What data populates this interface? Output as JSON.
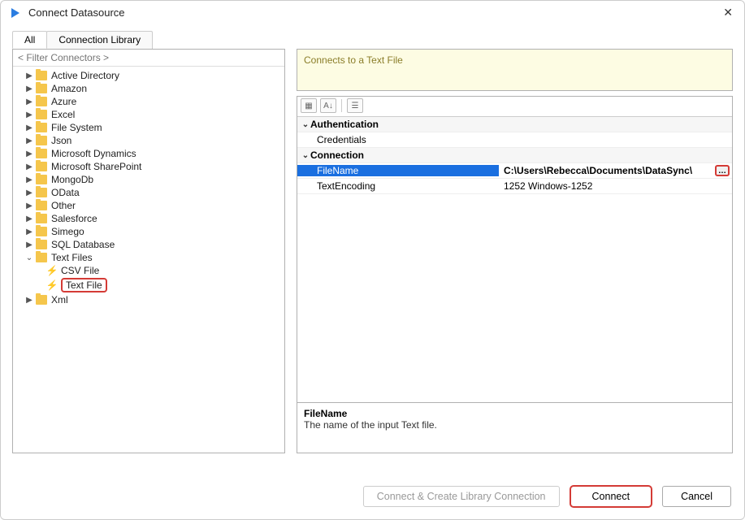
{
  "window": {
    "title": "Connect Datasource"
  },
  "tabs": [
    {
      "label": "All",
      "active": true
    },
    {
      "label": "Connection Library",
      "active": false
    }
  ],
  "filter_placeholder": "< Filter Connectors >",
  "tree": {
    "folders_collapsed": [
      "Active Directory",
      "Amazon",
      "Azure",
      "Excel",
      "File System",
      "Json",
      "Microsoft Dynamics",
      "Microsoft SharePoint",
      "MongoDb",
      "OData",
      "Other",
      "Salesforce",
      "Simego",
      "SQL Database"
    ],
    "expanded": {
      "label": "Text Files",
      "children": [
        {
          "label": "CSV File",
          "highlighted": false
        },
        {
          "label": "Text File",
          "highlighted": true
        }
      ]
    },
    "folders_after": [
      "Xml"
    ]
  },
  "description": "Connects to a Text File",
  "propgrid": {
    "categories": [
      {
        "name": "Authentication",
        "rows": [
          {
            "name": "Credentials",
            "value": ""
          }
        ]
      },
      {
        "name": "Connection",
        "rows": [
          {
            "name": "FileName",
            "value": "C:\\Users\\Rebecca\\Documents\\DataSync\\pro",
            "selected": true,
            "ellipsis": true
          },
          {
            "name": "TextEncoding",
            "value": "1252    Windows-1252"
          }
        ]
      }
    ],
    "help_title": "FileName",
    "help_text": "The name of the input Text file."
  },
  "buttons": {
    "create_lib": "Connect & Create Library Connection",
    "connect": "Connect",
    "cancel": "Cancel"
  }
}
